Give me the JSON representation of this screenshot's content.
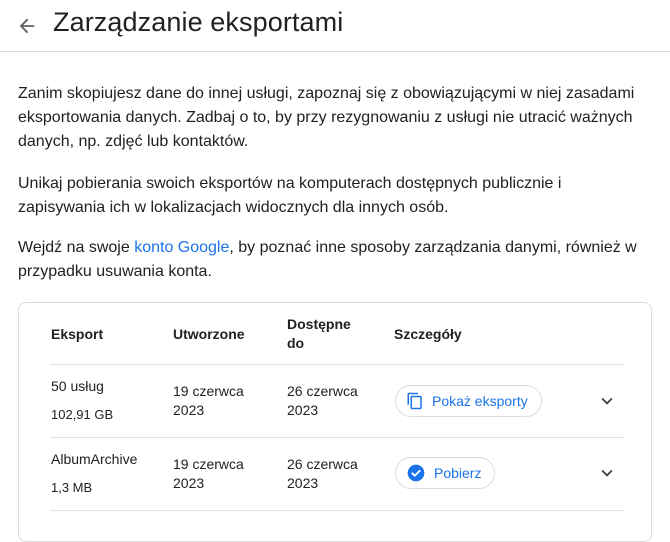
{
  "header": {
    "title": "Zarządzanie eksportami"
  },
  "intro": {
    "p1": "Zanim skopiujesz dane do innej usługi, zapoznaj się z obowiązującymi w niej zasadami eksportowania danych. Zadbaj o to, by przy rezygnowaniu z usługi nie utracić ważnych danych, np. zdjęć lub kontaktów.",
    "p2": "Unikaj pobierania swoich eksportów na komputerach dostępnych publicznie i zapisywania ich w lokalizacjach widocznych dla innych osób.",
    "p3_before": "Wejdź na swoje ",
    "p3_link": "konto Google",
    "p3_after": ", by poznać inne sposoby zarządzania danymi, również w przypadku usuwania konta."
  },
  "table": {
    "headers": {
      "export": "Eksport",
      "created": "Utworzone",
      "available_line1": "Dostępne",
      "available_line2": "do",
      "details": "Szczegóły"
    },
    "rows": [
      {
        "name": "50 usług",
        "size": "102,91 GB",
        "created_line1": "19 czerwca",
        "created_line2": "2023",
        "available_line1": "26 czerwca",
        "available_line2": "2023",
        "action": "Pokaż eksporty",
        "action_icon": "copy-icon"
      },
      {
        "name": "AlbumArchive",
        "size": "1,3 MB",
        "created_line1": "19 czerwca",
        "created_line2": "2023",
        "available_line1": "26 czerwca",
        "available_line2": "2023",
        "action": "Pobierz",
        "action_icon": "check-circle-icon"
      }
    ]
  },
  "colors": {
    "accent": "#1a73e8",
    "text": "#202124",
    "border": "#dadce0"
  }
}
